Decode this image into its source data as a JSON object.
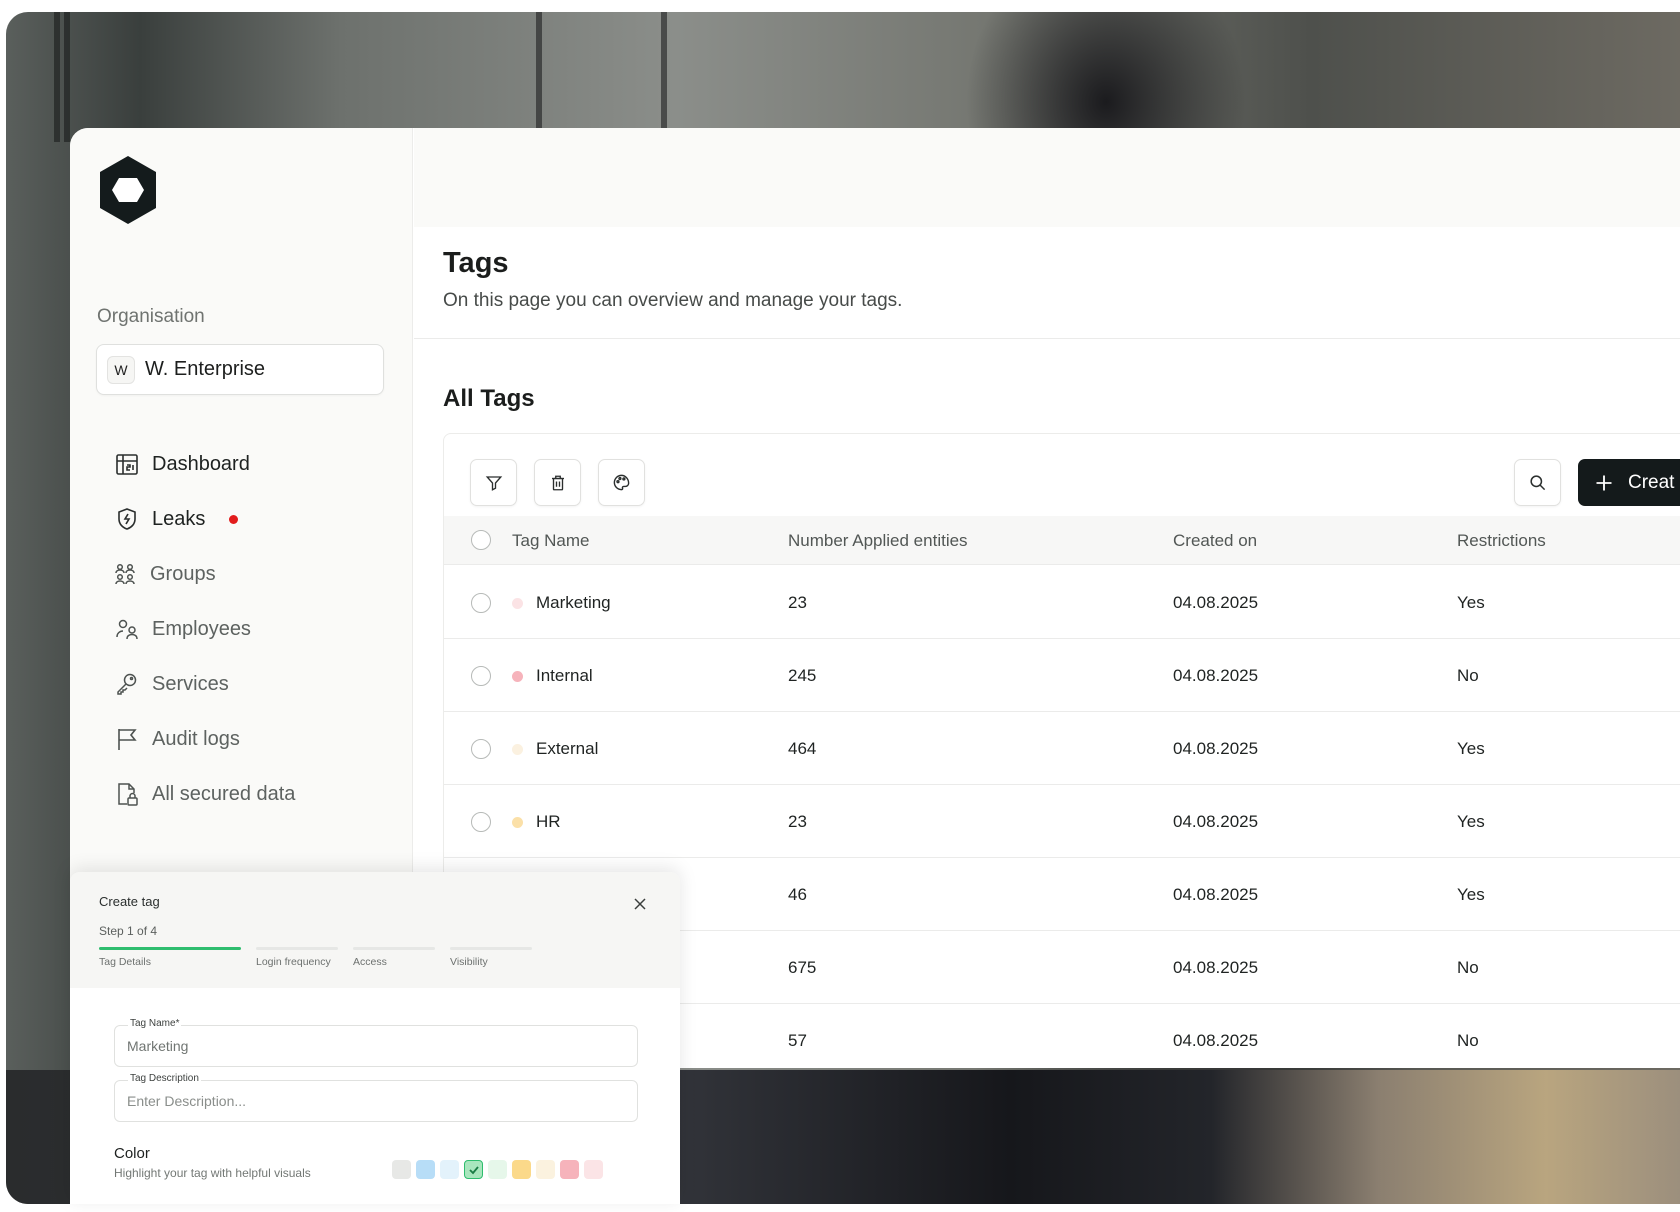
{
  "sidebar": {
    "org_label": "Organisation",
    "org_initial": "W",
    "org_name": "W. Enterprise",
    "items": [
      {
        "label": "Dashboard",
        "icon": "calendar-icon"
      },
      {
        "label": "Leaks",
        "icon": "shield-bolt-icon",
        "alert": true
      },
      {
        "label": "Groups",
        "icon": "groups-icon"
      },
      {
        "label": "Employees",
        "icon": "employees-icon"
      },
      {
        "label": "Services",
        "icon": "key-icon"
      },
      {
        "label": "Audit logs",
        "icon": "flag-icon"
      },
      {
        "label": "All secured data",
        "icon": "file-lock-icon"
      }
    ]
  },
  "page": {
    "title": "Tags",
    "subtitle": "On this page you can overview and manage your tags.",
    "section_title": "All Tags"
  },
  "toolbar": {
    "create_label": "Creat"
  },
  "table": {
    "columns": [
      "Tag Name",
      "Number Applied entities",
      "Created on",
      "Restrictions"
    ],
    "rows": [
      {
        "name": "Marketing",
        "count": "23",
        "created": "04.08.2025",
        "restrictions": "Yes",
        "dot_color": "#fbe3e5"
      },
      {
        "name": "Internal",
        "count": "245",
        "created": "04.08.2025",
        "restrictions": "No",
        "dot_color": "#f6b3bb"
      },
      {
        "name": "External",
        "count": "464",
        "created": "04.08.2025",
        "restrictions": "Yes",
        "dot_color": "#fbf1e0"
      },
      {
        "name": "HR",
        "count": "23",
        "created": "04.08.2025",
        "restrictions": "Yes",
        "dot_color": "#fbe0a8"
      },
      {
        "name": "",
        "count": "46",
        "created": "04.08.2025",
        "restrictions": "Yes",
        "dot_color": ""
      },
      {
        "name": "",
        "count": "675",
        "created": "04.08.2025",
        "restrictions": "No",
        "dot_color": ""
      },
      {
        "name": "",
        "count": "57",
        "created": "04.08.2025",
        "restrictions": "No",
        "dot_color": ""
      }
    ]
  },
  "modal": {
    "title": "Create tag",
    "step": "Step 1 of 4",
    "steps": [
      "Tag Details",
      "Login frequency",
      "Access",
      "Visibility"
    ],
    "active_step": 0,
    "tag_name_label": "Tag Name*",
    "tag_name_value": "Marketing",
    "tag_desc_label": "Tag Description",
    "tag_desc_placeholder": "Enter Description...",
    "color_title": "Color",
    "color_subtitle": "Highlight your tag with helpful visuals",
    "swatches": [
      "#e7e8e6",
      "#b7ddf7",
      "#e3f2fb",
      "#a8e6bd",
      "#e6f7ea",
      "#fbd98a",
      "#fbf2df",
      "#f6b3bb",
      "#fbe4e6"
    ],
    "selected_swatch": 3
  },
  "colors": {
    "accent_dark": "#141a1b",
    "progress_active": "#2ebd6e",
    "alert_red": "#e21c1c"
  }
}
